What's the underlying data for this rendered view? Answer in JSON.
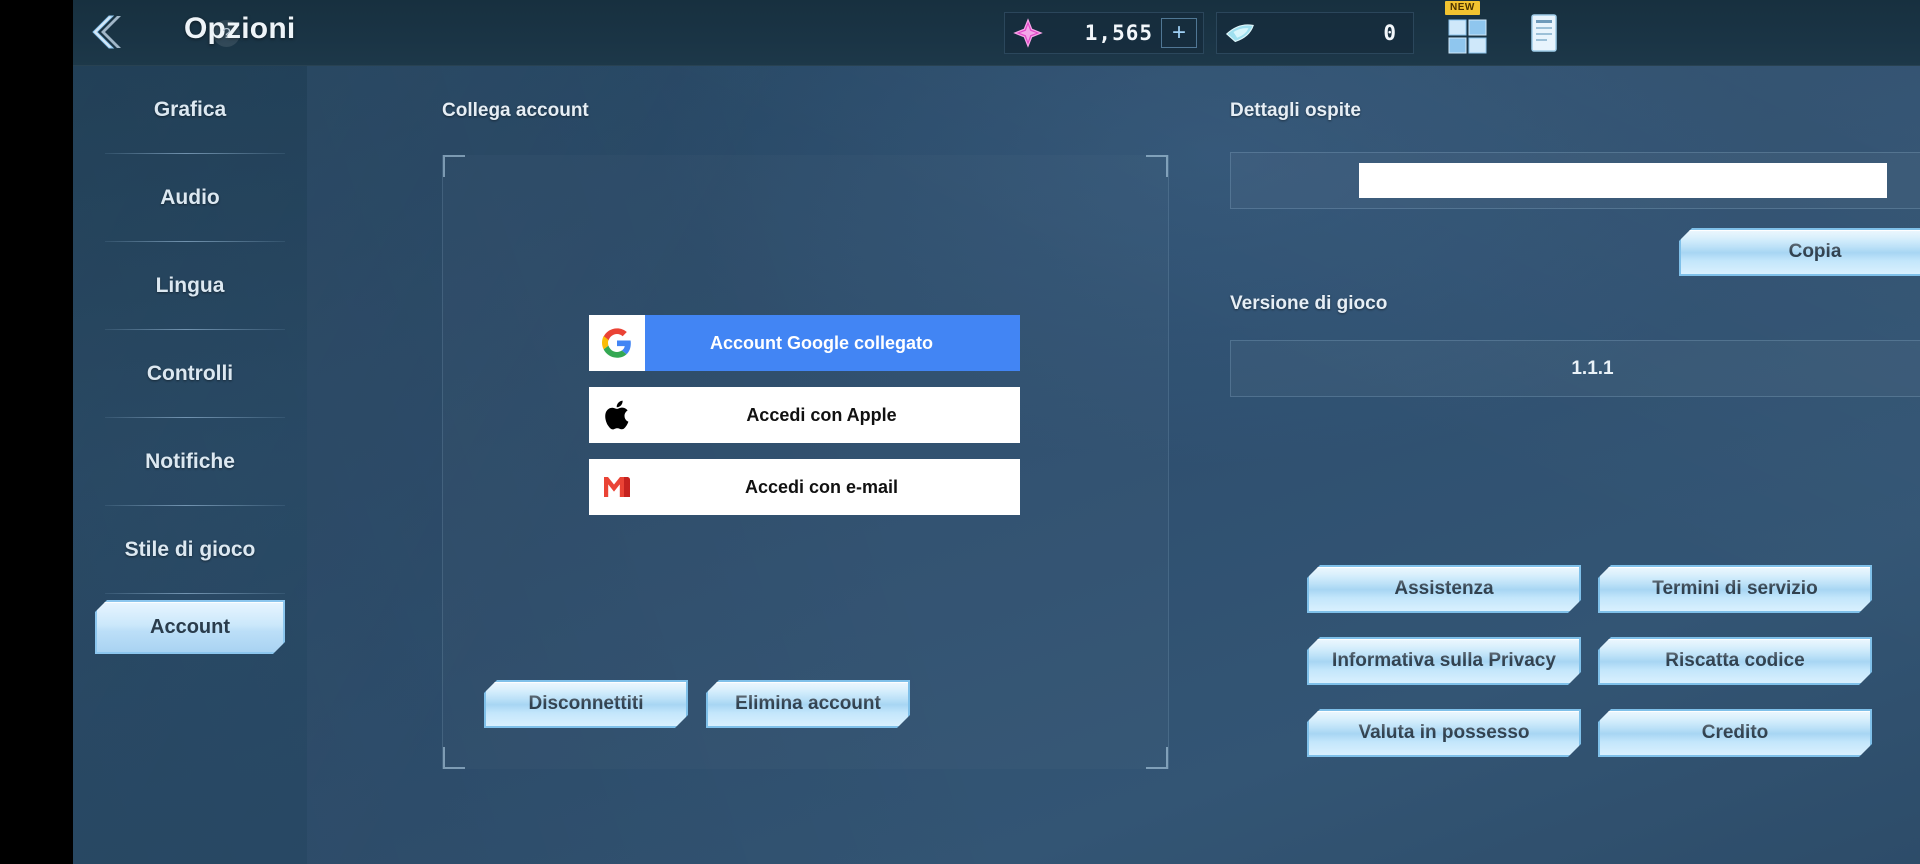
{
  "header": {
    "title": "Opzioni",
    "help_label": "?",
    "back_icon": "back-chevron-icon",
    "currencies": [
      {
        "icon": "gem-star-icon",
        "value": "1,565",
        "plus_label": "+"
      },
      {
        "icon": "diamond-card-icon",
        "value": "0"
      }
    ],
    "new_badge": "NEW",
    "grid_icon": "grid-apps-icon",
    "news_icon": "news-page-icon"
  },
  "sidebar": {
    "items": [
      {
        "label": "Grafica",
        "selected": false
      },
      {
        "label": "Audio",
        "selected": false
      },
      {
        "label": "Lingua",
        "selected": false
      },
      {
        "label": "Controlli",
        "selected": false
      },
      {
        "label": "Notifiche",
        "selected": false
      },
      {
        "label": "Stile di gioco",
        "selected": false
      },
      {
        "label": "Account",
        "selected": true
      }
    ]
  },
  "main": {
    "link_account": {
      "section_label": "Collega account",
      "buttons": [
        {
          "label": "Account Google collegato",
          "icon": "google-g-icon",
          "state": "linked"
        },
        {
          "label": "Accedi con Apple",
          "icon": "apple-logo-icon",
          "state": "available"
        },
        {
          "label": "Accedi con e-mail",
          "icon": "gmail-m-icon",
          "state": "available"
        }
      ],
      "sign_out_label": "Disconnettiti",
      "delete_account_label": "Elimina account"
    },
    "guest_details": {
      "section_label": "Dettagli ospite",
      "value": "",
      "placeholder": "",
      "copy_label": "Copia"
    },
    "game_version": {
      "section_label": "Versione di gioco",
      "value": "1.1.1"
    },
    "links_grid": [
      {
        "label": "Assistenza"
      },
      {
        "label": "Termini di servizio"
      },
      {
        "label": "Informativa sulla Privacy"
      },
      {
        "label": "Riscatta codice"
      },
      {
        "label": "Valuta in possesso"
      },
      {
        "label": "Credito"
      }
    ]
  },
  "colors": {
    "accent": "#a8d6f3",
    "google_blue": "#4285f4",
    "panel_bg": "#2f5070",
    "topbar_bg": "#1a3445",
    "new_badge": "#f2c330"
  }
}
